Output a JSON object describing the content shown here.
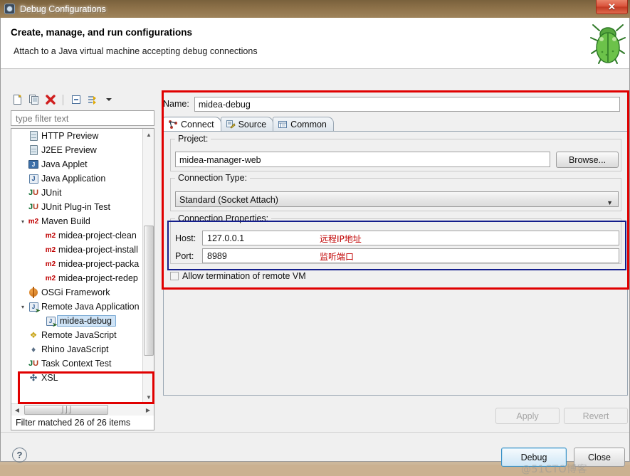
{
  "window": {
    "title": "Debug Configurations",
    "title_icon": "gear-icon",
    "close_label": "✕"
  },
  "banner": {
    "title": "Create, manage, and run configurations",
    "subtitle": "Attach to a Java virtual machine accepting debug connections",
    "icon": "green-bug-icon"
  },
  "left_panel": {
    "toolbar": [
      {
        "name": "new-configuration-icon",
        "glyph": "὜B"
      },
      {
        "name": "duplicate-configuration-icon",
        "glyph": ""
      },
      {
        "name": "delete-configuration-icon",
        "glyph": "✖"
      },
      {
        "name": "collapse-all-icon",
        "glyph": ""
      },
      {
        "name": "filter-icon",
        "glyph": ""
      },
      {
        "name": "view-menu-chevron-down-icon",
        "glyph": "▼"
      }
    ],
    "filter_placeholder": "type filter text",
    "filter_value": "",
    "status": "Filter matched 26 of 26 items",
    "tree": [
      {
        "label": "HTTP Preview",
        "icon": "server-icon",
        "level": 1,
        "expander": "",
        "selected": false
      },
      {
        "label": "J2EE Preview",
        "icon": "server-icon",
        "level": 1,
        "expander": "",
        "selected": false
      },
      {
        "label": "Java Applet",
        "icon": "java-applet-icon",
        "level": 1,
        "expander": "",
        "selected": false
      },
      {
        "label": "Java Application",
        "icon": "java-app-icon",
        "level": 1,
        "expander": "",
        "selected": false
      },
      {
        "label": "JUnit",
        "icon": "junit-icon",
        "level": 1,
        "expander": "",
        "selected": false
      },
      {
        "label": "JUnit Plug-in Test",
        "icon": "junit-plugin-icon",
        "level": 1,
        "expander": "",
        "selected": false
      },
      {
        "label": "Maven Build",
        "icon": "m2-icon",
        "level": 1,
        "expander": "▾",
        "selected": false
      },
      {
        "label": "midea-project-clean",
        "icon": "m2-icon",
        "level": 2,
        "expander": "",
        "selected": false
      },
      {
        "label": "midea-project-install",
        "icon": "m2-icon",
        "level": 2,
        "expander": "",
        "selected": false
      },
      {
        "label": "midea-project-packa",
        "icon": "m2-icon",
        "level": 2,
        "expander": "",
        "selected": false
      },
      {
        "label": "midea-project-redep",
        "icon": "m2-icon",
        "level": 2,
        "expander": "",
        "selected": false
      },
      {
        "label": "OSGi Framework",
        "icon": "osgi-icon",
        "level": 1,
        "expander": "",
        "selected": false
      },
      {
        "label": "Remote Java Application",
        "icon": "remote-java-icon",
        "level": 1,
        "expander": "▾",
        "selected": false
      },
      {
        "label": "midea-debug",
        "icon": "remote-java-icon",
        "level": 2,
        "expander": "",
        "selected": true
      },
      {
        "label": "Remote JavaScript",
        "icon": "remote-js-icon",
        "level": 1,
        "expander": "",
        "selected": false
      },
      {
        "label": "Rhino JavaScript",
        "icon": "rhino-icon",
        "level": 1,
        "expander": "",
        "selected": false
      },
      {
        "label": "Task Context Test",
        "icon": "junit-icon",
        "level": 1,
        "expander": "",
        "selected": false
      },
      {
        "label": "XSL",
        "icon": "xsl-icon",
        "level": 1,
        "expander": "",
        "selected": false
      }
    ]
  },
  "right_panel": {
    "name_label": "Name:",
    "name_value": "midea-debug",
    "tabs": [
      {
        "label": "Connect",
        "icon": "connect-icon",
        "active": true
      },
      {
        "label": "Source",
        "icon": "source-icon",
        "active": false
      },
      {
        "label": "Common",
        "icon": "common-icon",
        "active": false
      }
    ],
    "project": {
      "group_title": "Project:",
      "value": "midea-manager-web",
      "browse_label": "Browse..."
    },
    "connection_type": {
      "group_title": "Connection Type:",
      "selected": "Standard (Socket Attach)",
      "options": [
        "Standard (Socket Attach)"
      ]
    },
    "connection_properties": {
      "group_title": "Connection Properties:",
      "host_label": "Host:",
      "host_value": "127.0.0.1",
      "host_note": "远程IP地址",
      "port_label": "Port:",
      "port_value": "8989",
      "port_note": "监听端口"
    },
    "allow_termination": {
      "label": "Allow termination of remote VM",
      "checked": false
    },
    "apply_label": "Apply",
    "revert_label": "Revert"
  },
  "footer": {
    "help_glyph": "?",
    "debug_label": "Debug",
    "close_label": "Close",
    "watermark": "@51CTO博客"
  },
  "colors": {
    "highlight_red": "#e00000",
    "highlight_blue": "#141e8c",
    "selection_blue": "#cfe4f7",
    "annotation_red": "#c00000"
  }
}
